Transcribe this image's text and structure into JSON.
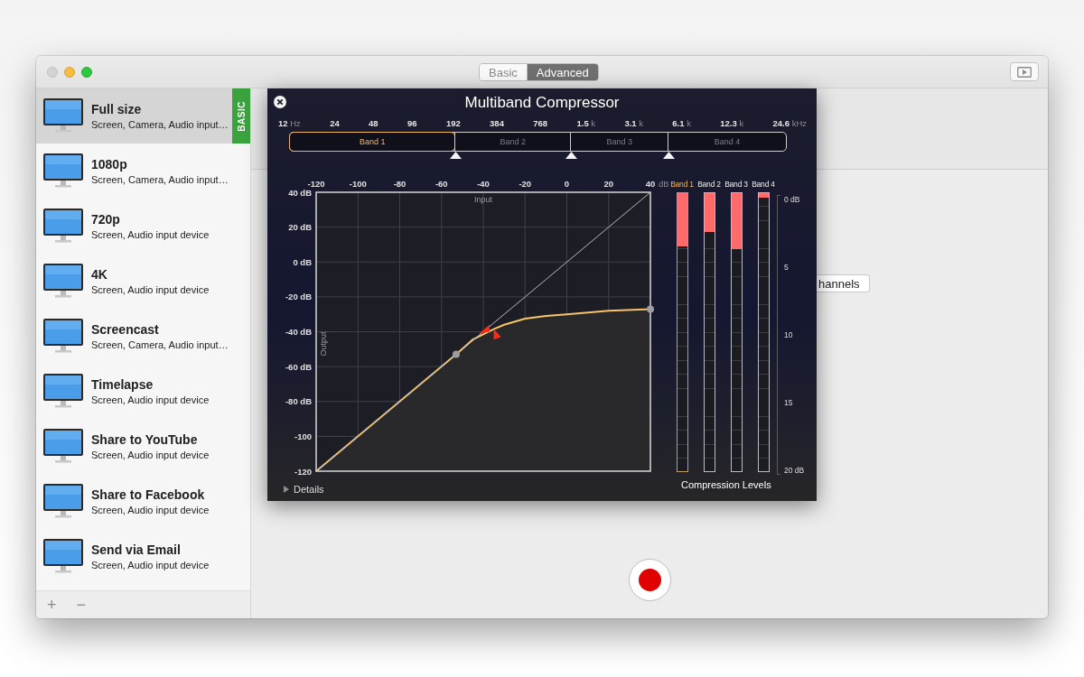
{
  "mode_tabs": [
    {
      "label": "Basic",
      "selected": false
    },
    {
      "label": "Advanced",
      "selected": true
    }
  ],
  "presets": [
    {
      "name": "Full size",
      "details": "Screen, Camera, Audio input…",
      "selected": true,
      "badge": "BASIC"
    },
    {
      "name": "1080p",
      "details": "Screen, Camera, Audio input…",
      "selected": false
    },
    {
      "name": "720p",
      "details": "Screen, Audio input device",
      "selected": false
    },
    {
      "name": "4K",
      "details": "Screen, Audio input device",
      "selected": false
    },
    {
      "name": "Screencast",
      "details": "Screen, Camera, Audio input…",
      "selected": false
    },
    {
      "name": "Timelapse",
      "details": "Screen, Audio input device",
      "selected": false
    },
    {
      "name": "Share to YouTube",
      "details": "Screen, Audio input device",
      "selected": false
    },
    {
      "name": "Share to Facebook",
      "details": "Screen, Audio input device",
      "selected": false
    },
    {
      "name": "Send via Email",
      "details": "Screen, Audio input device",
      "selected": false
    }
  ],
  "sidebar_footer": {
    "add": "+",
    "remove": "−"
  },
  "channels_button": {
    "label": "hannels"
  },
  "compressor": {
    "title": "Multiband Compressor",
    "frequencies": [
      {
        "value": "12",
        "unit": "Hz"
      },
      {
        "value": "24"
      },
      {
        "value": "48"
      },
      {
        "value": "96"
      },
      {
        "value": "192"
      },
      {
        "value": "384"
      },
      {
        "value": "768"
      },
      {
        "value": "1.5",
        "unit": "k"
      },
      {
        "value": "3.1",
        "unit": "k"
      },
      {
        "value": "6.1",
        "unit": "k"
      },
      {
        "value": "12.3",
        "unit": "k"
      },
      {
        "value": "24.6",
        "unit": "kHz"
      }
    ],
    "bands": [
      {
        "label": "Band 1",
        "selected": true
      },
      {
        "label": "Band 2",
        "selected": false
      },
      {
        "label": "Band 3",
        "selected": false
      },
      {
        "label": "Band 4",
        "selected": false
      }
    ],
    "x_unit": "dB",
    "chart_data": {
      "type": "line",
      "xlabel": "Input",
      "ylabel": "Output",
      "x": [
        -120,
        -53,
        -45,
        -40,
        -35,
        -30,
        -20,
        -10,
        0,
        20,
        40
      ],
      "series": [
        {
          "color": "#f6c46a",
          "values": [
            -120,
            -53,
            -44.5,
            -41.5,
            -38.5,
            -36,
            -32.5,
            -31,
            -30,
            -28,
            -27
          ]
        },
        {
          "color": "#bbbbbb",
          "values": [
            -120,
            -53,
            -45,
            -40,
            -35,
            -30,
            -20,
            -10,
            0,
            20,
            40
          ]
        }
      ],
      "xlim": [
        -120,
        40
      ],
      "ylim": [
        -120,
        40
      ],
      "grid": true,
      "xticks": [
        -120,
        -100,
        -80,
        -60,
        -40,
        -20,
        0,
        20,
        40
      ],
      "yticks": [
        {
          "value": 40,
          "label": "40 dB"
        },
        {
          "value": 20,
          "label": "20 dB"
        },
        {
          "value": 0,
          "label": "0 dB"
        },
        {
          "value": -20,
          "label": "-20 dB"
        },
        {
          "value": -40,
          "label": "-40 dB"
        },
        {
          "value": -60,
          "label": "-60 dB"
        },
        {
          "value": -80,
          "label": "-80 dB"
        },
        {
          "value": -100,
          "label": "-100"
        },
        {
          "value": -120,
          "label": "-120"
        }
      ]
    },
    "meters": [
      {
        "label": "Band 1",
        "selected": true,
        "level": 0.19
      },
      {
        "label": "Band 2",
        "selected": false,
        "level": 0.14
      },
      {
        "label": "Band 3",
        "selected": false,
        "level": 0.2
      },
      {
        "label": "Band 4",
        "selected": false,
        "level": 0.015
      }
    ],
    "meter_scale": [
      "0 dB",
      "5",
      "10",
      "15",
      "20 dB"
    ],
    "meters_title": "Compression Levels",
    "details": {
      "label": "Details",
      "expanded": false
    }
  }
}
